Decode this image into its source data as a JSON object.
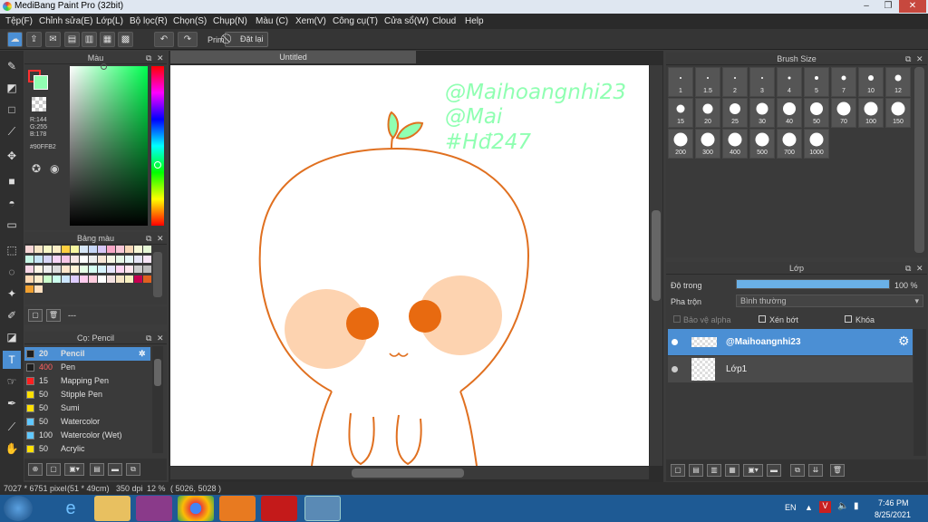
{
  "window": {
    "title": "MediBang Paint Pro (32bit)",
    "min": "–",
    "max": "❐",
    "close": "✕"
  },
  "menu": [
    "Tệp(F)",
    "Chỉnh sửa(E)",
    "Lớp(L)",
    "Bộ lọc(R)",
    "Chọn(S)",
    "Chụp(N)",
    "Màu (C)",
    "Xem(V)",
    "Công cụ(T)",
    "Cửa sổ(W)",
    "Cloud",
    "Help"
  ],
  "toolbar": {
    "prim_label": "Prim",
    "reset_label": "Đặt lại"
  },
  "color_panel": {
    "title": "Màu",
    "rgb_r": "R:144",
    "rgb_g": "G:255",
    "rgb_b": "B:178",
    "hex": "#90FFB2",
    "primary": "#90ffb2",
    "secondary": "#ff3030"
  },
  "palette_panel": {
    "title": "Bảng màu",
    "name": "---",
    "swatches": [
      "#f7d6d6",
      "#f7e6c6",
      "#f7f7c6",
      "#fbeec6",
      "#ffd040",
      "#f7f7a0",
      "#d6e6f7",
      "#c6d6f7",
      "#d6c6f7",
      "#f7a6c6",
      "#f7c6d6",
      "#f7d6b6",
      "#f7f7d6",
      "#e6f7d6",
      "#c6f7e6",
      "#c6e6f7",
      "#d6d6f7",
      "#f7d6f7",
      "#f7c6e6",
      "#f7e6e6",
      "#ffffff",
      "#eeeeee",
      "#f7e6d6",
      "#f7f7e6",
      "#e6f7e6",
      "#e6f7f7",
      "#e6e6f7",
      "#f7e6f7",
      "#f7d6e6",
      "#fff7e6",
      "#eeeeee",
      "#dddddd",
      "#ffe6cc",
      "#fff3d6",
      "#e6ffe6",
      "#d6fff3",
      "#d6f3ff",
      "#e6e6ff",
      "#ffd6f3",
      "#ffe6ee",
      "#cccccc",
      "#bbbbbb",
      "#ffd9b3",
      "#ffeecc",
      "#ccffcc",
      "#ccffee",
      "#cce6ff",
      "#ddccff",
      "#ffccee",
      "#ffccdd",
      "#ffffff",
      "#f3e0e0",
      "#f7e6c6",
      "#f7f0c0",
      "#c60050",
      "#e06020",
      "#f0a030",
      "#ffe0c0"
    ]
  },
  "brush_panel": {
    "title": "Cọ: Pencil",
    "items": [
      {
        "size": "20",
        "name": "Pencil",
        "color": "#1e1e1e",
        "active": true
      },
      {
        "size": "400",
        "name": "Pen",
        "color": "#1e1e1e"
      },
      {
        "size": "15",
        "name": "Mapping Pen",
        "color": "#ff2020"
      },
      {
        "size": "50",
        "name": "Stipple Pen",
        "color": "#ffe000"
      },
      {
        "size": "50",
        "name": "Sumi",
        "color": "#ffe000"
      },
      {
        "size": "50",
        "name": "Watercolor",
        "color": "#60c8ff"
      },
      {
        "size": "100",
        "name": "Watercolor (Wet)",
        "color": "#60c8ff"
      },
      {
        "size": "50",
        "name": "Acrylic",
        "color": "#ffe000"
      }
    ]
  },
  "canvas": {
    "title": "Untitled",
    "text_lines": [
      "@Maihoangnhi23",
      "@Mai",
      "#Hđ247"
    ],
    "text_color": "#90ffb2",
    "line_color": "#e07020",
    "cheek_color": "#fdd3b0",
    "eye_color": "#e86a10"
  },
  "brushsize_panel": {
    "title": "Brush Size",
    "sizes": [
      "1",
      "1.5",
      "2",
      "3",
      "4",
      "5",
      "7",
      "10",
      "12",
      "15",
      "20",
      "25",
      "30",
      "40",
      "50",
      "70",
      "100",
      "150",
      "200",
      "300",
      "400",
      "500",
      "700",
      "1000"
    ]
  },
  "layer_panel": {
    "title": "Lớp",
    "opacity_label": "Độ trong",
    "opacity_value": "100 %",
    "opacity_fraction": 1.0,
    "blend_label": "Pha trộn",
    "blend_value": "Bình thường",
    "protect_alpha": "Bảo vệ alpha",
    "clipping": "Xén bớt",
    "lock": "Khóa",
    "layers": [
      {
        "name": "@Maihoangnhi23",
        "active": true
      },
      {
        "name": "Lớp1",
        "active": false
      }
    ]
  },
  "status": {
    "size": "7027 * 6751 pixel",
    "cm": "(51 * 49cm)",
    "dpi": "350 dpi",
    "zoom": "12 %",
    "coords": "( 5026, 5028 )"
  },
  "taskbar": {
    "lang": "EN",
    "time": "7:46 PM",
    "date": "8/25/2021"
  }
}
